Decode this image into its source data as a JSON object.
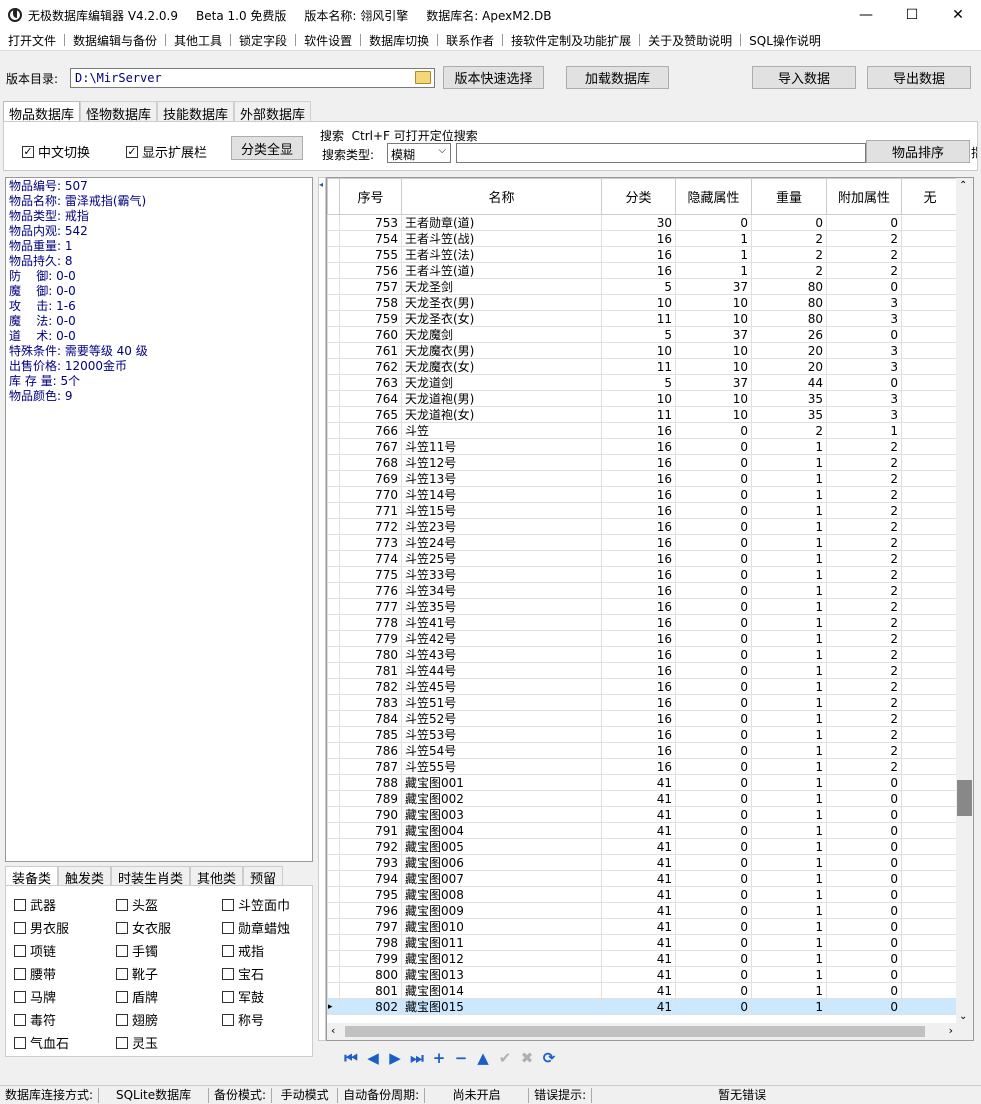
{
  "titlebar": {
    "app": "无极数据库编辑器 V4.2.0.9",
    "edition": "Beta 1.0 免费版",
    "version_name": "版本名称: 翎风引擎",
    "db_name": "数据库名: ApexM2.DB",
    "minimize": "—",
    "maximize": "☐",
    "close": "✕"
  },
  "menu": [
    "打开文件",
    "数据编辑与备份",
    "其他工具",
    "锁定字段",
    "软件设置",
    "数据库切换",
    "联系作者",
    "接软件定制及功能扩展",
    "关于及赞助说明",
    "SQL操作说明"
  ],
  "path": {
    "label": "版本目录:",
    "value": "D:\\MirServer",
    "quick_select": "版本快速选择",
    "load_db": "加载数据库",
    "import": "导入数据",
    "export": "导出数据"
  },
  "tabs": [
    "物品数据库",
    "怪物数据库",
    "技能数据库",
    "外部数据库"
  ],
  "options": {
    "chinese_switch": "中文切换",
    "show_ext": "显示扩展栏",
    "show_all": "分类全显",
    "search_title": "搜索  Ctrl+F 可打开定位搜索",
    "search_type_label": "搜索类型:",
    "search_type_value": "模糊",
    "sort_button": "物品排序",
    "clipped_char": "指"
  },
  "item_info": [
    "物品编号: 507",
    "物品名称: 雷泽戒指(霸气)",
    "物品类型: 戒指",
    "物品内观: 542",
    "物品重量: 1",
    "物品持久: 8",
    "防    御: 0-0",
    "魔    御: 0-0",
    "攻    击: 1-6",
    "魔    法: 0-0",
    "道    术: 0-0",
    "特殊条件: 需要等级 40 级",
    "出售价格: 12000金币",
    "库 存 量: 5个",
    "物品颜色: 9"
  ],
  "category_tabs": [
    "装备类",
    "触发类",
    "时装生肖类",
    "其他类",
    "预留"
  ],
  "categories": [
    [
      "武器",
      "头盔",
      "斗笠面巾"
    ],
    [
      "男衣服",
      "女衣服",
      "勋章蜡烛"
    ],
    [
      "项链",
      "手镯",
      "戒指"
    ],
    [
      "腰带",
      "靴子",
      "宝石"
    ],
    [
      "马牌",
      "盾牌",
      "军鼓"
    ],
    [
      "毒符",
      "翅膀",
      "称号"
    ],
    [
      "气血石",
      "灵玉",
      ""
    ]
  ],
  "grid": {
    "columns": [
      "序号",
      "名称",
      "分类",
      "隐藏属性",
      "重量",
      "附加属性",
      "无"
    ],
    "row_marker": "▸",
    "rows": [
      [
        "753",
        "王者勋章(道)",
        "30",
        "0",
        "0",
        "0"
      ],
      [
        "754",
        "王者斗笠(战)",
        "16",
        "1",
        "2",
        "2"
      ],
      [
        "755",
        "王者斗笠(法)",
        "16",
        "1",
        "2",
        "2"
      ],
      [
        "756",
        "王者斗笠(道)",
        "16",
        "1",
        "2",
        "2"
      ],
      [
        "757",
        "天龙圣剑",
        "5",
        "37",
        "80",
        "0"
      ],
      [
        "758",
        "天龙圣衣(男)",
        "10",
        "10",
        "80",
        "3"
      ],
      [
        "759",
        "天龙圣衣(女)",
        "11",
        "10",
        "80",
        "3"
      ],
      [
        "760",
        "天龙魔剑",
        "5",
        "37",
        "26",
        "0"
      ],
      [
        "761",
        "天龙魔衣(男)",
        "10",
        "10",
        "20",
        "3"
      ],
      [
        "762",
        "天龙魔衣(女)",
        "11",
        "10",
        "20",
        "3"
      ],
      [
        "763",
        "天龙道剑",
        "5",
        "37",
        "44",
        "0"
      ],
      [
        "764",
        "天龙道袍(男)",
        "10",
        "10",
        "35",
        "3"
      ],
      [
        "765",
        "天龙道袍(女)",
        "11",
        "10",
        "35",
        "3"
      ],
      [
        "766",
        "斗笠",
        "16",
        "0",
        "2",
        "1"
      ],
      [
        "767",
        "斗笠11号",
        "16",
        "0",
        "1",
        "2"
      ],
      [
        "768",
        "斗笠12号",
        "16",
        "0",
        "1",
        "2"
      ],
      [
        "769",
        "斗笠13号",
        "16",
        "0",
        "1",
        "2"
      ],
      [
        "770",
        "斗笠14号",
        "16",
        "0",
        "1",
        "2"
      ],
      [
        "771",
        "斗笠15号",
        "16",
        "0",
        "1",
        "2"
      ],
      [
        "772",
        "斗笠23号",
        "16",
        "0",
        "1",
        "2"
      ],
      [
        "773",
        "斗笠24号",
        "16",
        "0",
        "1",
        "2"
      ],
      [
        "774",
        "斗笠25号",
        "16",
        "0",
        "1",
        "2"
      ],
      [
        "775",
        "斗笠33号",
        "16",
        "0",
        "1",
        "2"
      ],
      [
        "776",
        "斗笠34号",
        "16",
        "0",
        "1",
        "2"
      ],
      [
        "777",
        "斗笠35号",
        "16",
        "0",
        "1",
        "2"
      ],
      [
        "778",
        "斗笠41号",
        "16",
        "0",
        "1",
        "2"
      ],
      [
        "779",
        "斗笠42号",
        "16",
        "0",
        "1",
        "2"
      ],
      [
        "780",
        "斗笠43号",
        "16",
        "0",
        "1",
        "2"
      ],
      [
        "781",
        "斗笠44号",
        "16",
        "0",
        "1",
        "2"
      ],
      [
        "782",
        "斗笠45号",
        "16",
        "0",
        "1",
        "2"
      ],
      [
        "783",
        "斗笠51号",
        "16",
        "0",
        "1",
        "2"
      ],
      [
        "784",
        "斗笠52号",
        "16",
        "0",
        "1",
        "2"
      ],
      [
        "785",
        "斗笠53号",
        "16",
        "0",
        "1",
        "2"
      ],
      [
        "786",
        "斗笠54号",
        "16",
        "0",
        "1",
        "2"
      ],
      [
        "787",
        "斗笠55号",
        "16",
        "0",
        "1",
        "2"
      ],
      [
        "788",
        "藏宝图001",
        "41",
        "0",
        "1",
        "0"
      ],
      [
        "789",
        "藏宝图002",
        "41",
        "0",
        "1",
        "0"
      ],
      [
        "790",
        "藏宝图003",
        "41",
        "0",
        "1",
        "0"
      ],
      [
        "791",
        "藏宝图004",
        "41",
        "0",
        "1",
        "0"
      ],
      [
        "792",
        "藏宝图005",
        "41",
        "0",
        "1",
        "0"
      ],
      [
        "793",
        "藏宝图006",
        "41",
        "0",
        "1",
        "0"
      ],
      [
        "794",
        "藏宝图007",
        "41",
        "0",
        "1",
        "0"
      ],
      [
        "795",
        "藏宝图008",
        "41",
        "0",
        "1",
        "0"
      ],
      [
        "796",
        "藏宝图009",
        "41",
        "0",
        "1",
        "0"
      ],
      [
        "797",
        "藏宝图010",
        "41",
        "0",
        "1",
        "0"
      ],
      [
        "798",
        "藏宝图011",
        "41",
        "0",
        "1",
        "0"
      ],
      [
        "799",
        "藏宝图012",
        "41",
        "0",
        "1",
        "0"
      ],
      [
        "800",
        "藏宝图013",
        "41",
        "0",
        "1",
        "0"
      ],
      [
        "801",
        "藏宝图014",
        "41",
        "0",
        "1",
        "0"
      ],
      [
        "802",
        "藏宝图015",
        "41",
        "0",
        "1",
        "0"
      ]
    ],
    "selected_id": "802"
  },
  "nav": [
    {
      "name": "first-record-icon",
      "glyph": "⏮",
      "enabled": true
    },
    {
      "name": "prev-record-icon",
      "glyph": "◀",
      "enabled": true
    },
    {
      "name": "next-record-icon",
      "glyph": "▶",
      "enabled": true
    },
    {
      "name": "last-record-icon",
      "glyph": "⏭",
      "enabled": true
    },
    {
      "name": "add-record-icon",
      "glyph": "+",
      "enabled": true
    },
    {
      "name": "delete-record-icon",
      "glyph": "−",
      "enabled": true
    },
    {
      "name": "edit-record-icon",
      "glyph": "▲",
      "enabled": true
    },
    {
      "name": "post-record-icon",
      "glyph": "✔",
      "enabled": false
    },
    {
      "name": "cancel-record-icon",
      "glyph": "✖",
      "enabled": false
    },
    {
      "name": "refresh-icon",
      "glyph": "⟳",
      "enabled": true
    }
  ],
  "status": {
    "conn_label": "数据库连接方式:",
    "conn_value": "SQLite数据库",
    "backup_label": "备份模式:",
    "backup_value": "手动模式",
    "auto_label": "自动备份周期:",
    "auto_value": "尚未开启",
    "err_label": "错误提示:",
    "err_value": "暂无错误"
  }
}
